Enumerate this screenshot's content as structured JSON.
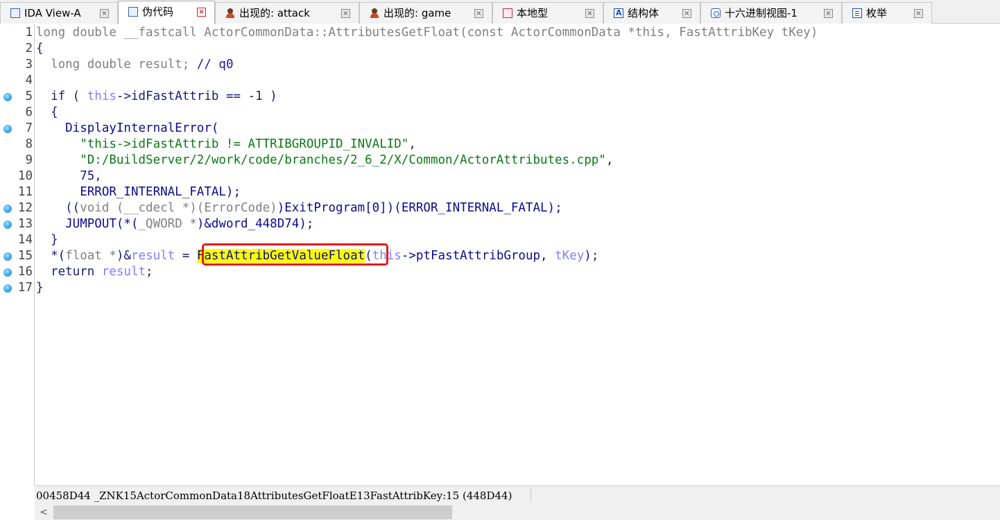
{
  "tabs": [
    {
      "label": "IDA View-A",
      "icon": "ida-view-icon",
      "active": false
    },
    {
      "label": "伪代码",
      "icon": "pseudocode-icon",
      "active": true
    },
    {
      "label": "出现的: attack",
      "icon": "person-icon",
      "active": false
    },
    {
      "label": "出现的: game",
      "icon": "person-icon",
      "active": false
    },
    {
      "label": "本地型",
      "icon": "local-types-icon",
      "active": false
    },
    {
      "label": "结构体",
      "icon": "structures-icon",
      "active": false
    },
    {
      "label": "十六进制视图-1",
      "icon": "hex-view-icon",
      "active": false
    },
    {
      "label": "枚举",
      "icon": "enums-icon",
      "active": false
    }
  ],
  "code": {
    "lines": [
      {
        "n": "1",
        "bp": false,
        "segs": [
          {
            "t": "long double __fastcall ActorCommonData::AttributesGetFloat(const ActorCommonData *this, FastAttribKey tKey)",
            "c": "gray"
          }
        ]
      },
      {
        "n": "2",
        "bp": false,
        "segs": [
          {
            "t": "{",
            "c": "kw"
          }
        ]
      },
      {
        "n": "3",
        "bp": false,
        "segs": [
          {
            "t": "  long double result; ",
            "c": "gray"
          },
          {
            "t": "// q0",
            "c": "cmt"
          }
        ]
      },
      {
        "n": "4",
        "bp": false,
        "segs": []
      },
      {
        "n": "5",
        "bp": true,
        "segs": [
          {
            "t": "  if ( ",
            "c": "kw"
          },
          {
            "t": "this",
            "c": "var"
          },
          {
            "t": "->idFastAttrib == -1 )",
            "c": "kw"
          }
        ]
      },
      {
        "n": "6",
        "bp": false,
        "segs": [
          {
            "t": "  {",
            "c": "kw"
          }
        ]
      },
      {
        "n": "7",
        "bp": true,
        "segs": [
          {
            "t": "    DisplayInternalError(",
            "c": "func"
          }
        ]
      },
      {
        "n": "8",
        "bp": false,
        "segs": [
          {
            "t": "      ",
            "c": "kw"
          },
          {
            "t": "\"this->idFastAttrib != ATTRIBGROUPID_INVALID\"",
            "c": "str"
          },
          {
            "t": ",",
            "c": "kw"
          }
        ]
      },
      {
        "n": "9",
        "bp": false,
        "segs": [
          {
            "t": "      ",
            "c": "kw"
          },
          {
            "t": "\"D:/BuildServer/2/work/code/branches/2_6_2/X/Common/ActorAttributes.cpp\"",
            "c": "str"
          },
          {
            "t": ",",
            "c": "kw"
          }
        ]
      },
      {
        "n": "10",
        "bp": false,
        "segs": [
          {
            "t": "      75,",
            "c": "num"
          }
        ]
      },
      {
        "n": "11",
        "bp": false,
        "segs": [
          {
            "t": "      ERROR_INTERNAL_FATAL);",
            "c": "ident"
          }
        ]
      },
      {
        "n": "12",
        "bp": true,
        "segs": [
          {
            "t": "    ((",
            "c": "kw"
          },
          {
            "t": "void (__cdecl *)(ErrorCode)",
            "c": "gray"
          },
          {
            "t": ")ExitProgram[0])(ERROR_INTERNAL_FATAL);",
            "c": "ident"
          }
        ]
      },
      {
        "n": "13",
        "bp": true,
        "segs": [
          {
            "t": "    JUMPOUT(*(",
            "c": "ident"
          },
          {
            "t": "_QWORD *",
            "c": "gray"
          },
          {
            "t": ")&dword_448D74);",
            "c": "ident"
          }
        ]
      },
      {
        "n": "14",
        "bp": false,
        "segs": [
          {
            "t": "  }",
            "c": "kw"
          }
        ]
      },
      {
        "n": "15",
        "bp": true,
        "segs": [
          {
            "t": "  *(",
            "c": "kw"
          },
          {
            "t": "float *",
            "c": "gray"
          },
          {
            "t": ")&",
            "c": "kw"
          },
          {
            "t": "result",
            "c": "var"
          },
          {
            "t": " = ",
            "c": "kw"
          },
          {
            "t": "FastAttribGetValueFloat",
            "c": "hl"
          },
          {
            "t": "(",
            "c": "kw"
          },
          {
            "t": "this",
            "c": "var"
          },
          {
            "t": "->ptFastAttribGroup, ",
            "c": "ident"
          },
          {
            "t": "tKey",
            "c": "var"
          },
          {
            "t": ");",
            "c": "kw"
          }
        ]
      },
      {
        "n": "16",
        "bp": true,
        "segs": [
          {
            "t": "  return ",
            "c": "kw"
          },
          {
            "t": "result",
            "c": "var"
          },
          {
            "t": ";",
            "c": "kw"
          }
        ]
      },
      {
        "n": "17",
        "bp": true,
        "segs": [
          {
            "t": "}",
            "c": "kw"
          }
        ]
      }
    ]
  },
  "status": {
    "text": "00458D44 _ZNK15ActorCommonData18AttributesGetFloatE13FastAttribKey:15 (448D44)"
  },
  "scrollbar": {
    "left_arrow": "<"
  }
}
